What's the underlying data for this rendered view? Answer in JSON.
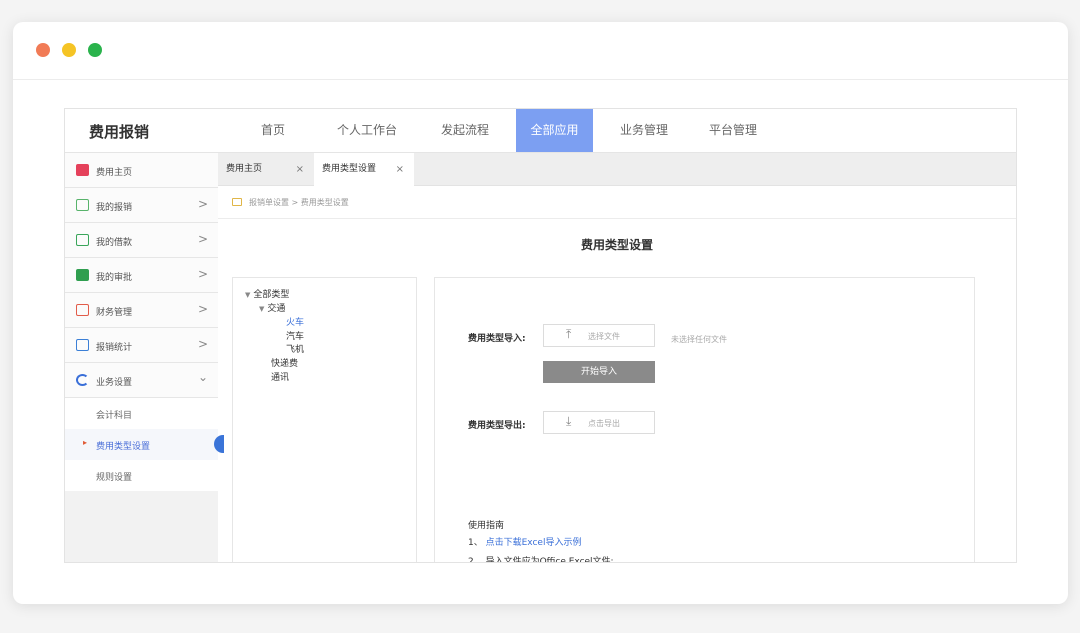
{
  "topnav": {
    "brand": "费用报销",
    "items": [
      "首页",
      "个人工作台",
      "发起流程",
      "全部应用",
      "业务管理",
      "平台管理"
    ],
    "active_index": 3
  },
  "sidebar": {
    "items": [
      {
        "label": "费用主页",
        "icon": "expense-home-icon",
        "color": "#e5415b"
      },
      {
        "label": "我的报销",
        "icon": "reimburse-icon",
        "color": "#58b36b",
        "arrow": ">"
      },
      {
        "label": "我的借款",
        "icon": "loan-icon",
        "color": "#3aa55a",
        "arrow": ">"
      },
      {
        "label": "我的审批",
        "icon": "approval-icon",
        "color": "#2f9e4f",
        "arrow": ">"
      },
      {
        "label": "财务管理",
        "icon": "finance-icon",
        "color": "#e25c4a",
        "arrow": ">"
      },
      {
        "label": "报销统计",
        "icon": "stats-icon",
        "color": "#3b7fd6",
        "arrow": ">"
      },
      {
        "label": "业务设置",
        "icon": "settings-icon",
        "color": "#3a6fd8",
        "arrow": "⌄"
      }
    ],
    "subitems": [
      {
        "label": "会计科目"
      },
      {
        "label": "费用类型设置",
        "active": true
      },
      {
        "label": "规则设置"
      }
    ]
  },
  "tabs": [
    {
      "label": "费用主页",
      "close": "×"
    },
    {
      "label": "费用类型设置",
      "close": "×"
    }
  ],
  "breadcrumb": {
    "text": "报销单设置 > 费用类型设置"
  },
  "page_title": "费用类型设置",
  "tree": {
    "root": "全部类型",
    "traffic": "交通",
    "train": "火车",
    "car": "汽车",
    "plane": "飞机",
    "express": "快递费",
    "comms": "通讯",
    "caret": "▼"
  },
  "import": {
    "label": "费用类型导入:",
    "file_button": "选择文件",
    "no_file_hint": "未选择任何文件",
    "start_button": "开始导入"
  },
  "export": {
    "label": "费用类型导出:",
    "button": "点击导出"
  },
  "guide": {
    "title": "使用指南",
    "step1_num": "1、",
    "step1_link": "点击下载Excel导入示例",
    "step2": "2、 导入文件应为Office Excel文件;"
  },
  "colors": {
    "accent": "#7c9ff2",
    "link": "#3a6fd8",
    "import_button": "#8a8a8a"
  }
}
